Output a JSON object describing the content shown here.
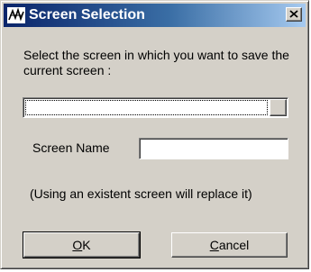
{
  "window": {
    "title": "Screen Selection",
    "icon": "app-logo-icon",
    "close_icon": "close-icon"
  },
  "dialog": {
    "prompt": "Select the screen in which you want to save the current screen :",
    "screen_combo": {
      "selected_value": "",
      "dropdown_icon": "dropdown-arrow-icon"
    },
    "screen_name": {
      "label": "Screen Name",
      "value": ""
    },
    "note": "(Using an existent screen will replace it)"
  },
  "buttons": {
    "ok_label": "OK",
    "cancel_label": "Cancel"
  },
  "colors": {
    "face": "#d4d0c8",
    "title_start": "#0a246a",
    "title_end": "#a6caf0"
  }
}
